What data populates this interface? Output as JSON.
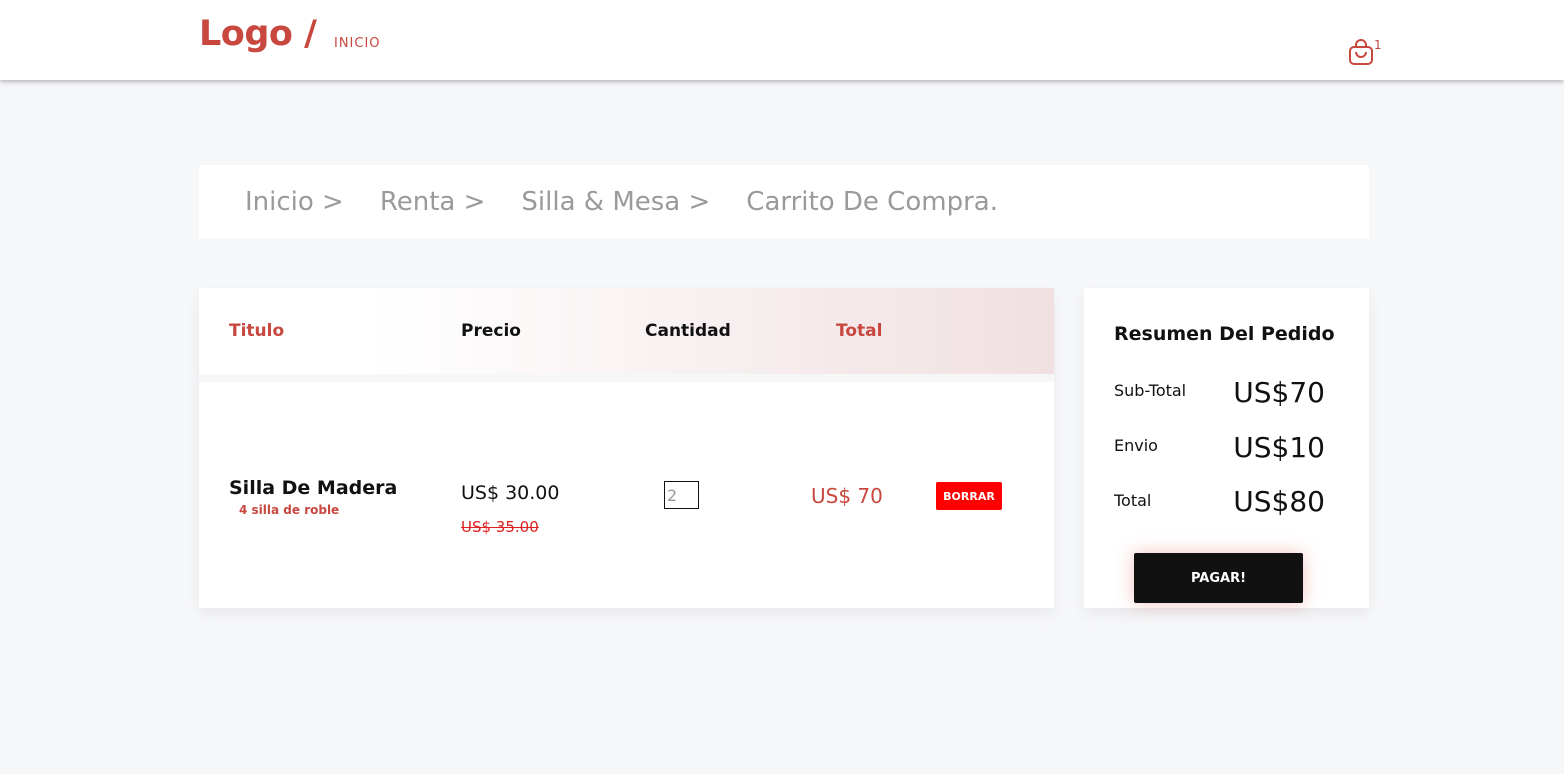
{
  "header": {
    "logo": "Logo /",
    "nav_link": "INICIO",
    "cart_count": "1"
  },
  "breadcrumb": {
    "items": [
      "Inicio >",
      "Renta >",
      "Silla & Mesa >",
      "Carrito De Compra."
    ]
  },
  "table": {
    "headers": {
      "title": "Titulo",
      "price": "Precio",
      "quantity": "Cantidad",
      "total": "Total"
    },
    "rows": [
      {
        "name": "Silla De Madera",
        "description": "4 silla de roble",
        "price": "US$ 30.00",
        "old_price": "US$ 35.00",
        "quantity": "2",
        "total": "US$ 70",
        "delete_label": "BORRAR"
      }
    ]
  },
  "summary": {
    "title": "Resumen Del Pedido",
    "subtotal_label": "Sub-Total",
    "subtotal_value": "US$70",
    "shipping_label": "Envio",
    "shipping_value": "US$10",
    "total_label": "Total",
    "total_value": "US$80",
    "pay_label": "PAGAR!"
  },
  "colors": {
    "accent": "#c8473f",
    "danger": "#ff0000",
    "dark": "#111111",
    "background": "#f6f7f9"
  },
  "icons": {
    "cart": "shopping-bag-icon"
  }
}
